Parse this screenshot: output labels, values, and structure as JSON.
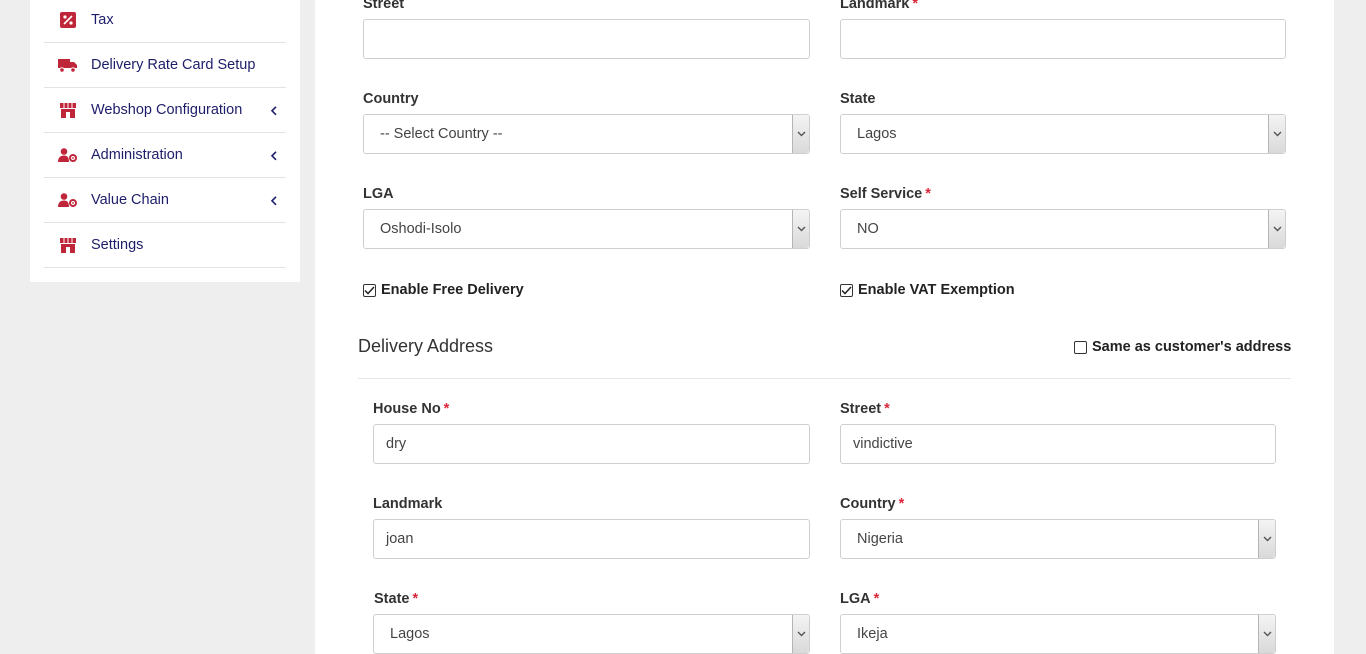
{
  "sidebar": {
    "items": [
      {
        "label": "Tax",
        "icon": "percent-icon",
        "has_submenu": false
      },
      {
        "label": "Delivery Rate Card Setup",
        "icon": "truck-icon",
        "has_submenu": false
      },
      {
        "label": "Webshop Configuration",
        "icon": "store-icon",
        "has_submenu": true
      },
      {
        "label": "Administration",
        "icon": "user-gear-icon",
        "has_submenu": true
      },
      {
        "label": "Value Chain",
        "icon": "user-gear-icon",
        "has_submenu": true
      },
      {
        "label": "Settings",
        "icon": "store-icon",
        "has_submenu": false
      }
    ],
    "icon_color": "#c0263a",
    "label_color": "#1d1d6a"
  },
  "form": {
    "street": {
      "label": "Street",
      "value": ""
    },
    "landmark": {
      "label": "Landmark",
      "required_mark": "*",
      "value": ""
    },
    "country": {
      "label": "Country",
      "value": "-- Select Country --"
    },
    "state": {
      "label": "State",
      "value": "Lagos"
    },
    "lga": {
      "label": "LGA",
      "value": "Oshodi-Isolo"
    },
    "self_service": {
      "label": "Self Service",
      "required_mark": "*",
      "value": "NO"
    },
    "enable_free_delivery": {
      "label": "Enable Free Delivery",
      "checked": true
    },
    "enable_vat_exemption": {
      "label": "Enable VAT Exemption",
      "checked": true
    }
  },
  "delivery_address": {
    "title": "Delivery Address",
    "same_as_customer": {
      "label": "Same as customer's address",
      "checked": false
    },
    "house_no": {
      "label": "House No",
      "required_mark": "*",
      "value": "dry"
    },
    "street": {
      "label": "Street",
      "required_mark": "*",
      "value": "vindictive"
    },
    "landmark": {
      "label": "Landmark",
      "value": "joan"
    },
    "country": {
      "label": "Country",
      "required_mark": "*",
      "value": "Nigeria"
    },
    "state": {
      "label": "State",
      "required_mark": "*",
      "value": "Lagos"
    },
    "lga": {
      "label": "LGA",
      "required_mark": "*",
      "value": "Ikeja"
    }
  }
}
